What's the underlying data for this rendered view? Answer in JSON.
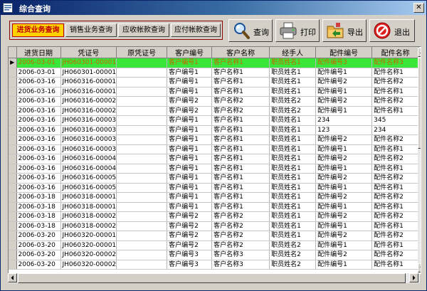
{
  "window": {
    "title": "综合查询",
    "close_glyph": "✕",
    "icon": "form-icon"
  },
  "tabs": [
    {
      "label": "进货业务查询",
      "active": true
    },
    {
      "label": "销售业务查询",
      "active": false
    },
    {
      "label": "应收帐款查询",
      "active": false
    },
    {
      "label": "应付帐款查询",
      "active": false
    }
  ],
  "toolbar": [
    {
      "label": "查询",
      "icon": "magnifier-icon"
    },
    {
      "label": "打印",
      "icon": "printer-icon"
    },
    {
      "label": "导出",
      "icon": "folder-export-icon"
    },
    {
      "label": "退出",
      "icon": "exit-icon"
    }
  ],
  "grid": {
    "columns": [
      "进货日期",
      "凭证号",
      "原凭证号",
      "客户编号",
      "客户名称",
      "经手人",
      "配件编号",
      "配件名称"
    ],
    "current_row_marker": "▶",
    "rows": [
      [
        "2006-03-01",
        "JH060301-00001",
        "",
        "客户编号1",
        "客户名称1",
        "职员姓名1",
        "配件编号3",
        "配件名称3"
      ],
      [
        "2006-03-01",
        "JH060301-00001",
        "",
        "客户编号1",
        "客户名称1",
        "职员姓名1",
        "配件编号1",
        "配件名称1"
      ],
      [
        "2006-03-16",
        "JH060316-00001",
        "",
        "客户编号1",
        "客户名称1",
        "职员姓名1",
        "配件编号2",
        "配件名称2"
      ],
      [
        "2006-03-16",
        "JH060316-00001",
        "",
        "客户编号1",
        "客户名称1",
        "职员姓名1",
        "配件编号1",
        "配件名称1"
      ],
      [
        "2006-03-16",
        "JH060316-00002",
        "",
        "客户编号2",
        "客户名称2",
        "职员姓名2",
        "配件编号2",
        "配件名称2"
      ],
      [
        "2006-03-16",
        "JH060316-00002",
        "",
        "客户编号2",
        "客户名称2",
        "职员姓名2",
        "配件编号1",
        "配件名称1"
      ],
      [
        "2006-03-16",
        "JH060316-00003",
        "",
        "客户编号1",
        "客户名称1",
        "职员姓名1",
        "234",
        "345"
      ],
      [
        "2006-03-16",
        "JH060316-00003",
        "",
        "客户编号1",
        "客户名称1",
        "职员姓名1",
        "123",
        "234"
      ],
      [
        "2006-03-16",
        "JH060316-00003",
        "",
        "客户编号1",
        "客户名称1",
        "职员姓名1",
        "配件编号2",
        "配件名称2"
      ],
      [
        "2006-03-16",
        "JH060316-00003",
        "",
        "客户编号1",
        "客户名称1",
        "职员姓名1",
        "配件编号1",
        "配件名称1"
      ],
      [
        "2006-03-16",
        "JH060316-00004",
        "",
        "客户编号1",
        "客户名称1",
        "职员姓名1",
        "配件编号2",
        "配件名称2"
      ],
      [
        "2006-03-16",
        "JH060316-00004",
        "",
        "客户编号1",
        "客户名称1",
        "职员姓名1",
        "配件编号1",
        "配件名称1"
      ],
      [
        "2006-03-16",
        "JH060316-00005",
        "",
        "客户编号1",
        "客户名称1",
        "职员姓名1",
        "配件编号2",
        "配件名称2"
      ],
      [
        "2006-03-16",
        "JH060316-00005",
        "",
        "客户编号1",
        "客户名称1",
        "职员姓名1",
        "配件编号1",
        "配件名称1"
      ],
      [
        "2006-03-18",
        "JH060318-00001",
        "",
        "客户编号1",
        "客户名称1",
        "职员姓名1",
        "配件编号2",
        "配件名称2"
      ],
      [
        "2006-03-18",
        "JH060318-00001",
        "",
        "客户编号1",
        "客户名称1",
        "职员姓名1",
        "配件编号1",
        "配件名称1"
      ],
      [
        "2006-03-18",
        "JH060318-00002",
        "",
        "客户编号2",
        "客户名称2",
        "职员姓名1",
        "配件编号2",
        "配件名称2"
      ],
      [
        "2006-03-18",
        "JH060318-00002",
        "",
        "客户编号2",
        "客户名称2",
        "职员姓名1",
        "配件编号1",
        "配件名称1"
      ],
      [
        "2006-03-20",
        "JH060320-00001",
        "",
        "客户编号2",
        "客户名称2",
        "职员姓名1",
        "配件编号2",
        "配件名称2"
      ],
      [
        "2006-03-20",
        "JH060320-00001",
        "",
        "客户编号2",
        "客户名称2",
        "职员姓名2",
        "配件编号1",
        "配件名称1"
      ],
      [
        "2006-03-20",
        "JH060320-00002",
        "",
        "客户编号3",
        "客户名称3",
        "职员姓名2",
        "配件编号2",
        "配件名称2"
      ],
      [
        "2006-03-20",
        "JH060320-00002",
        "",
        "客户编号3",
        "客户名称3",
        "职员姓名2",
        "配件编号1",
        "配件名称1"
      ]
    ]
  },
  "colors": {
    "selected_row_bg": "#39e639",
    "selected_row_text": "#c86400",
    "active_tab_bg": "#ffd200",
    "active_tab_text": "#c00000"
  }
}
